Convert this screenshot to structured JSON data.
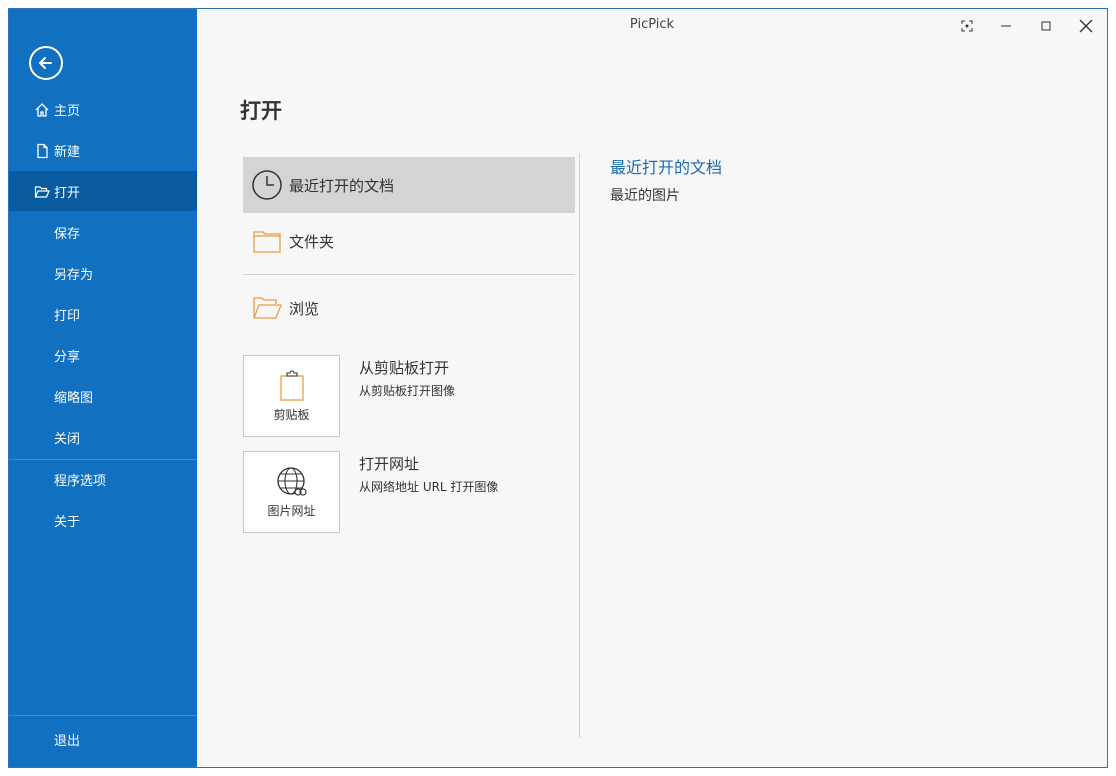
{
  "window": {
    "title": "PicPick"
  },
  "sidebar": {
    "items": [
      {
        "label": "主页",
        "icon": "home-icon"
      },
      {
        "label": "新建",
        "icon": "new-document-icon"
      },
      {
        "label": "打开",
        "icon": "open-folder-icon"
      },
      {
        "label": "保存"
      },
      {
        "label": "另存为"
      },
      {
        "label": "打印"
      },
      {
        "label": "分享"
      },
      {
        "label": "缩略图"
      },
      {
        "label": "关闭"
      },
      {
        "label": "程序选项"
      },
      {
        "label": "关于"
      },
      {
        "label": "退出"
      }
    ],
    "active_index": 2
  },
  "main": {
    "title": "打开",
    "options": [
      {
        "label": "最近打开的文档",
        "icon": "clock-icon"
      },
      {
        "label": "文件夹",
        "icon": "folder-icon"
      },
      {
        "label": "浏览",
        "icon": "open-folder-icon"
      }
    ],
    "tiles": [
      {
        "tile_label": "剪贴板",
        "title": "从剪贴板打开",
        "desc": "从剪贴板打开图像",
        "icon": "clipboard-icon"
      },
      {
        "tile_label": "图片网址",
        "title": "打开网址",
        "desc": "从网络地址 URL 打开图像",
        "icon": "globe-link-icon"
      }
    ]
  },
  "recent": {
    "heading": "最近打开的文档",
    "item": "最近的图片"
  },
  "colors": {
    "sidebar": "#1170c0",
    "sidebar_active": "#0a5aa0",
    "accent_text": "#1a6bb0",
    "folder_orange": "#e8a040"
  }
}
